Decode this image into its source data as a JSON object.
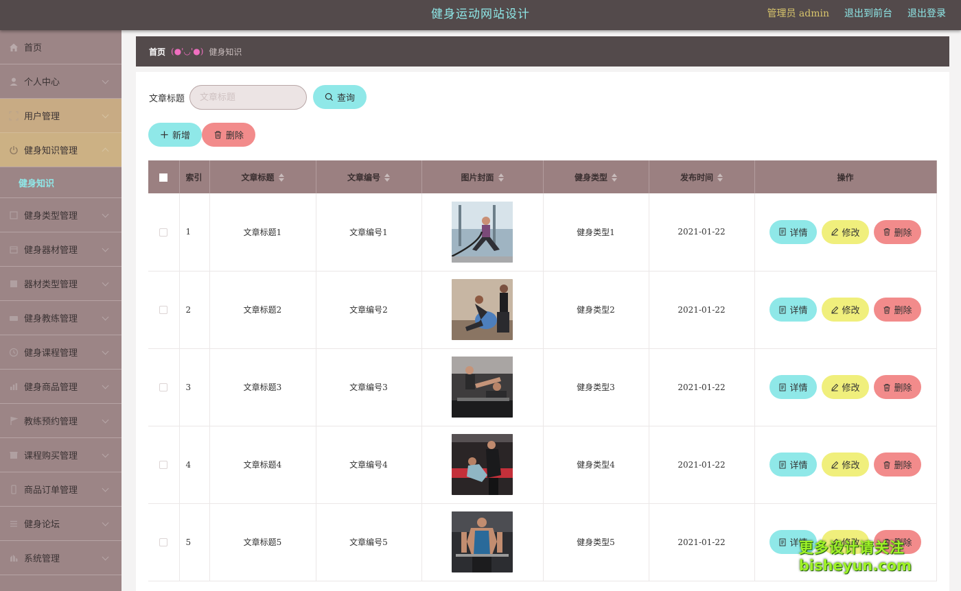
{
  "header": {
    "title": "健身运动网站设计",
    "user_label": "管理员 admin",
    "front_link": "退出到前台",
    "logout_link": "退出登录"
  },
  "sidebar": {
    "items": [
      {
        "label": "首页",
        "icon": "home-icon"
      },
      {
        "label": "个人中心",
        "icon": "user-icon"
      },
      {
        "label": "用户管理",
        "icon": "users-icon"
      },
      {
        "label": "健身知识管理",
        "icon": "power-icon",
        "sub": "健身知识"
      },
      {
        "label": "健身类型管理",
        "icon": "grid-icon"
      },
      {
        "label": "健身器材管理",
        "icon": "calendar-icon"
      },
      {
        "label": "器材类型管理",
        "icon": "box-icon"
      },
      {
        "label": "健身教练管理",
        "icon": "ticket-icon"
      },
      {
        "label": "健身课程管理",
        "icon": "clock-icon"
      },
      {
        "label": "健身商品管理",
        "icon": "chart-icon"
      },
      {
        "label": "教练预约管理",
        "icon": "flag-icon"
      },
      {
        "label": "课程购买管理",
        "icon": "shop-icon"
      },
      {
        "label": "商品订单管理",
        "icon": "phone-icon"
      },
      {
        "label": "健身论坛",
        "icon": "list-icon"
      },
      {
        "label": "系统管理",
        "icon": "settings-icon"
      }
    ]
  },
  "breadcrumb": {
    "home": "首页",
    "separator": "(●'◡'●)",
    "current": "健身知识"
  },
  "search": {
    "label": "文章标题",
    "placeholder": "文章标题",
    "query_button": "查询"
  },
  "actions": {
    "add_button": "新增",
    "delete_button": "删除"
  },
  "table": {
    "columns": [
      "索引",
      "文章标题",
      "文章编号",
      "图片封面",
      "健身类型",
      "发布时间",
      "操作"
    ],
    "rows": [
      {
        "index": "1",
        "title": "文章标题1",
        "code": "文章编号1",
        "type": "健身类型1",
        "date": "2021-01-22"
      },
      {
        "index": "2",
        "title": "文章标题2",
        "code": "文章编号2",
        "type": "健身类型2",
        "date": "2021-01-22"
      },
      {
        "index": "3",
        "title": "文章标题3",
        "code": "文章编号3",
        "type": "健身类型3",
        "date": "2021-01-22"
      },
      {
        "index": "4",
        "title": "文章标题4",
        "code": "文章编号4",
        "type": "健身类型4",
        "date": "2021-01-22"
      },
      {
        "index": "5",
        "title": "文章标题5",
        "code": "文章编号5",
        "type": "健身类型5",
        "date": "2021-01-22"
      }
    ],
    "row_actions": {
      "detail": "详情",
      "edit": "修改",
      "remove": "删除"
    }
  },
  "watermark": {
    "line1": "更多设计请关注",
    "line2": "bisheyun.com"
  },
  "colors": {
    "header_bg": "#534a4b",
    "sidebar_bg": "#9c8586",
    "accent_cyan": "#8fe8e8",
    "accent_yellow": "#f0ef7c",
    "accent_red": "#f28b8b",
    "table_header": "#9b8081"
  }
}
